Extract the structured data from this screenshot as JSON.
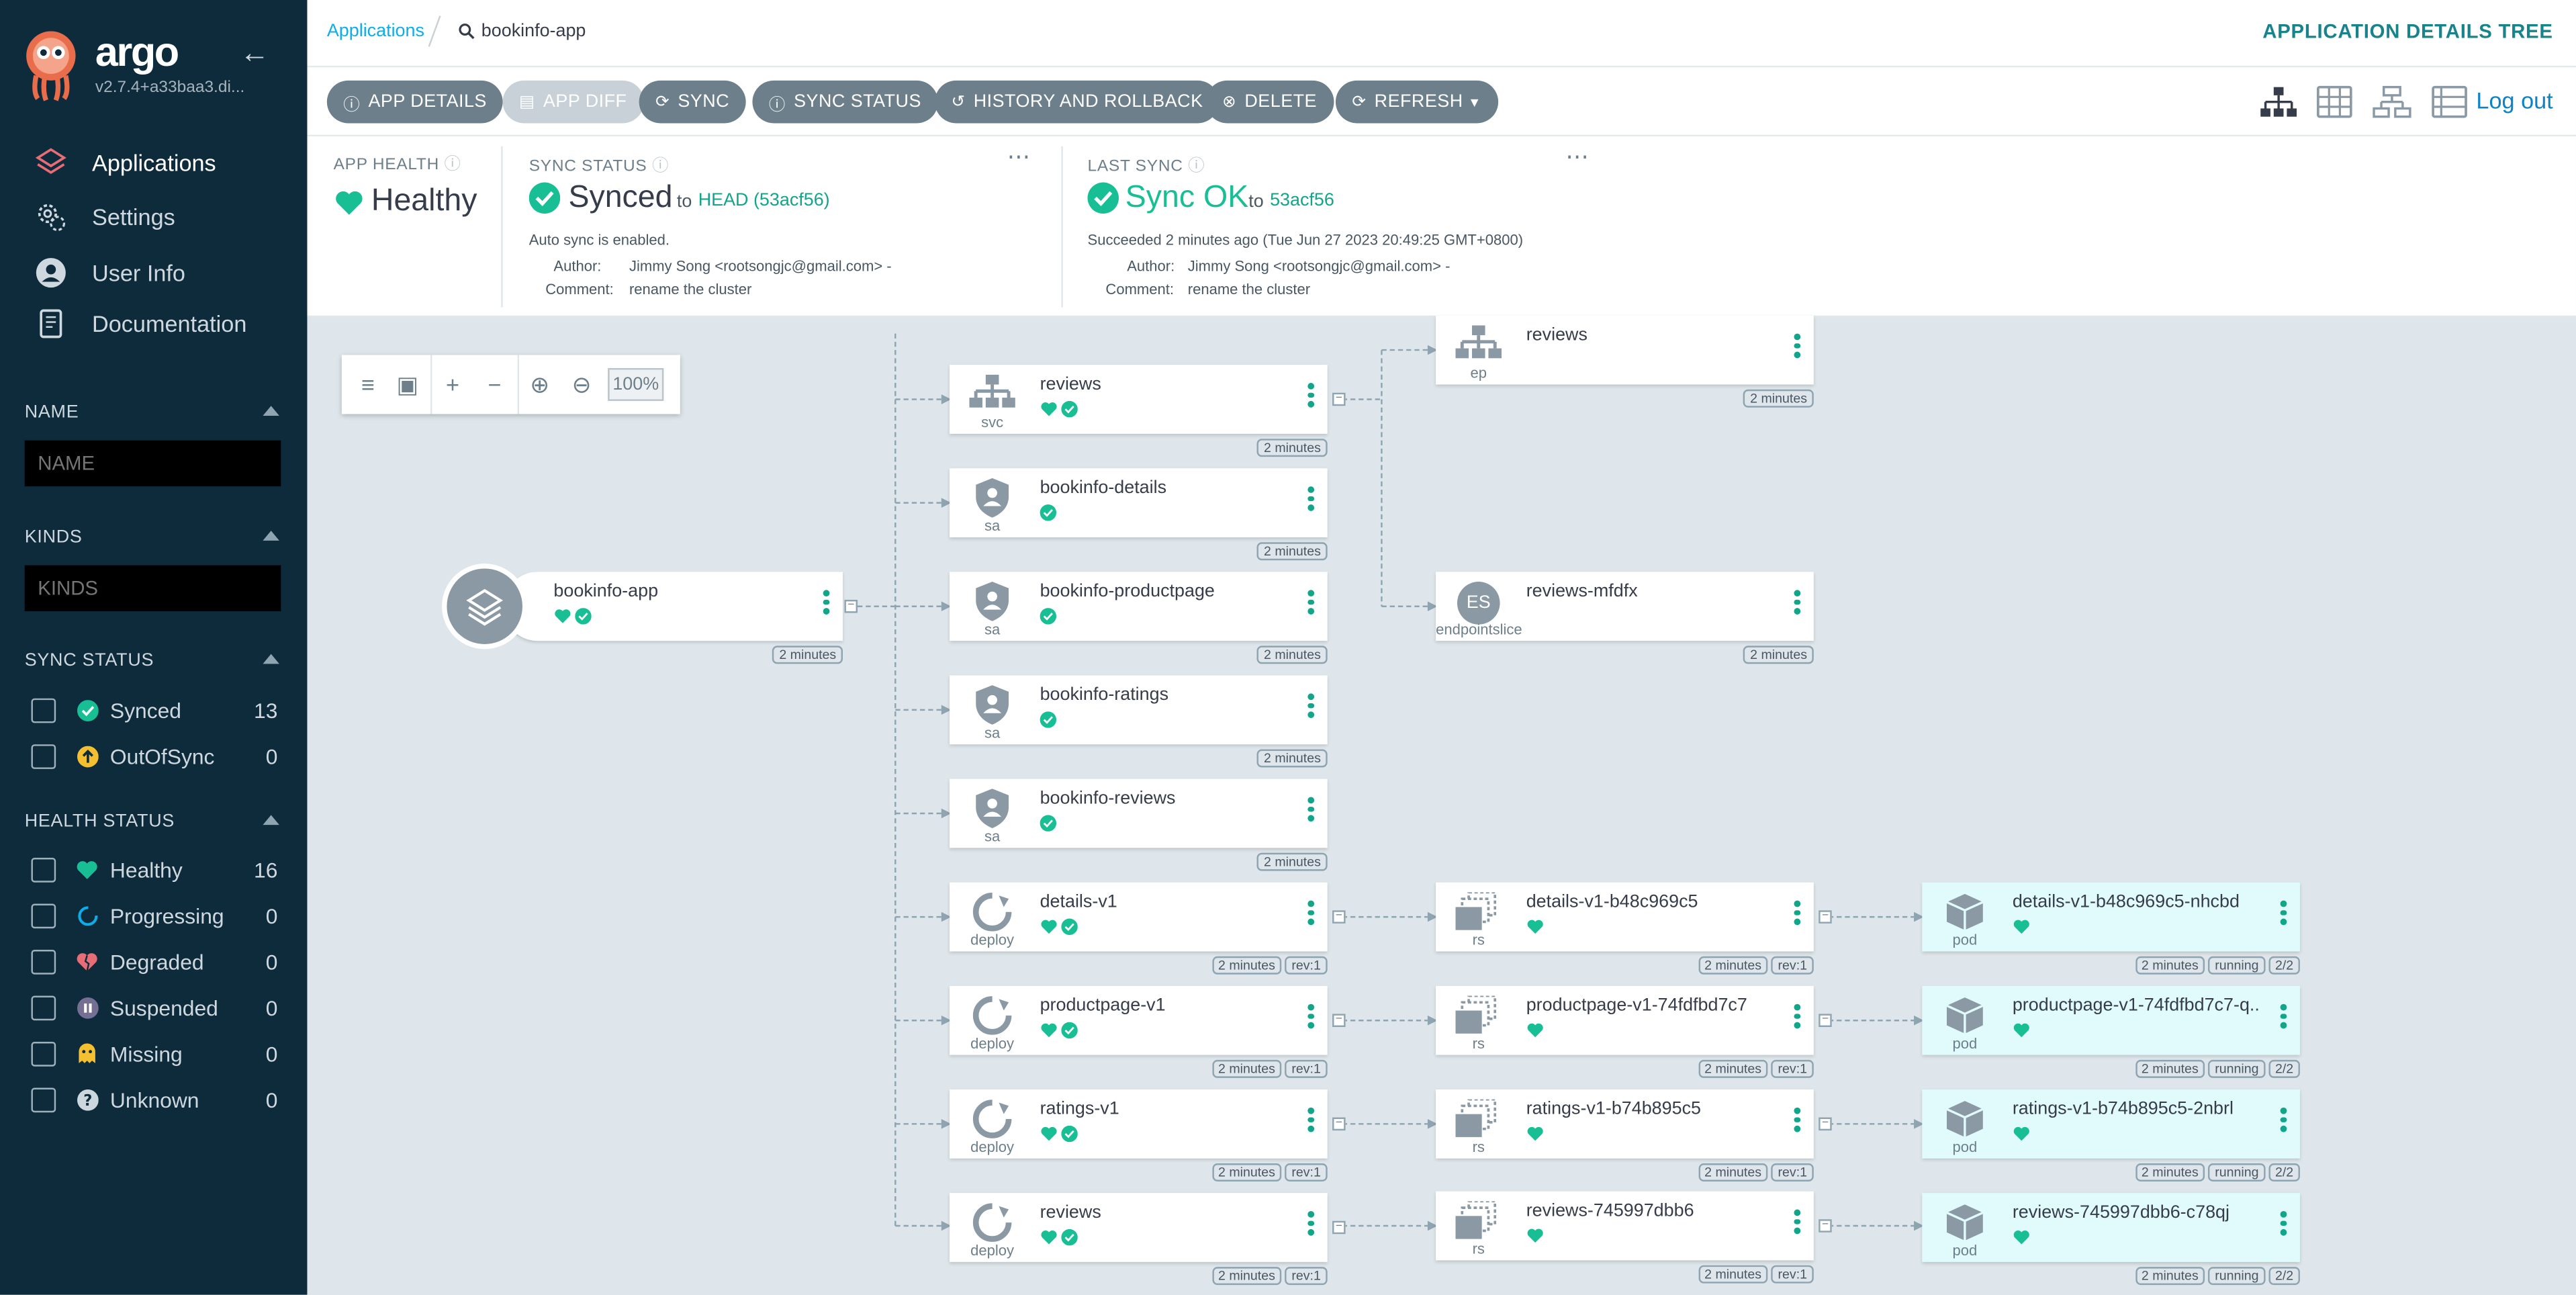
{
  "sidebar": {
    "brand": "argo",
    "version": "v2.7.4+a33baa3.di...",
    "nav": [
      {
        "label": "Applications",
        "icon": "layers-icon"
      },
      {
        "label": "Settings",
        "icon": "gears-icon"
      },
      {
        "label": "User Info",
        "icon": "user-icon"
      },
      {
        "label": "Documentation",
        "icon": "book-icon"
      }
    ],
    "filters": {
      "name_title": "NAME",
      "name_placeholder": "NAME",
      "kinds_title": "KINDS",
      "kinds_placeholder": "KINDS",
      "sync_title": "SYNC STATUS",
      "sync": [
        {
          "label": "Synced",
          "count": "13",
          "color": "#18be94"
        },
        {
          "label": "OutOfSync",
          "count": "0",
          "color": "#f4c030"
        }
      ],
      "health_title": "HEALTH STATUS",
      "health": [
        {
          "label": "Healthy",
          "count": "16",
          "color": "#18be94"
        },
        {
          "label": "Progressing",
          "count": "0",
          "color": "#0dadea"
        },
        {
          "label": "Degraded",
          "count": "0",
          "color": "#e96d76"
        },
        {
          "label": "Suspended",
          "count": "0",
          "color": "#766f94"
        },
        {
          "label": "Missing",
          "count": "0",
          "color": "#f4c030"
        },
        {
          "label": "Unknown",
          "count": "0",
          "color": "#ccd6dd"
        }
      ]
    }
  },
  "header": {
    "breadcrumb_root": "Applications",
    "breadcrumb_app": "bookinfo-app",
    "view_title": "APPLICATION DETAILS TREE",
    "logout": "Log out"
  },
  "toolbar": {
    "buttons": [
      "APP DETAILS",
      "APP DIFF",
      "SYNC",
      "SYNC STATUS",
      "HISTORY AND ROLLBACK",
      "DELETE",
      "REFRESH"
    ]
  },
  "status": {
    "health_title": "APP HEALTH",
    "health_value": "Healthy",
    "sync_title": "SYNC STATUS",
    "sync_value": "Synced",
    "sync_to": "to",
    "sync_rev": "HEAD (53acf56)",
    "auto_sync": "Auto sync is enabled.",
    "author_label": "Author:",
    "author": "Jimmy Song <rootsongjc@gmail.com> -",
    "comment_label": "Comment:",
    "comment": "rename the cluster",
    "last_title": "LAST SYNC",
    "last_value": "Sync OK",
    "last_to": "to",
    "last_rev": "53acf56",
    "succeeded": "Succeeded 2 minutes ago (Tue Jun 27 2023 20:49:25 GMT+0800)"
  },
  "zoom": {
    "percent": "100%"
  },
  "tree": {
    "root": {
      "name": "bookinfo-app",
      "age": "2 minutes"
    },
    "col1": [
      {
        "name": "reviews",
        "kind": "svc",
        "icon": "service-icon",
        "health": true,
        "tags": [
          "2 minutes"
        ]
      },
      {
        "name": "bookinfo-details",
        "kind": "sa",
        "icon": "serviceaccount-icon",
        "health": false,
        "tags": [
          "2 minutes"
        ]
      },
      {
        "name": "bookinfo-productpage",
        "kind": "sa",
        "icon": "serviceaccount-icon",
        "health": false,
        "tags": [
          "2 minutes"
        ]
      },
      {
        "name": "bookinfo-ratings",
        "kind": "sa",
        "icon": "serviceaccount-icon",
        "health": false,
        "tags": [
          "2 minutes"
        ]
      },
      {
        "name": "bookinfo-reviews",
        "kind": "sa",
        "icon": "serviceaccount-icon",
        "health": false,
        "tags": [
          "2 minutes"
        ]
      },
      {
        "name": "details-v1",
        "kind": "deploy",
        "icon": "deployment-icon",
        "health": true,
        "tags": [
          "2 minutes",
          "rev:1"
        ]
      },
      {
        "name": "productpage-v1",
        "kind": "deploy",
        "icon": "deployment-icon",
        "health": true,
        "tags": [
          "2 minutes",
          "rev:1"
        ]
      },
      {
        "name": "ratings-v1",
        "kind": "deploy",
        "icon": "deployment-icon",
        "health": true,
        "tags": [
          "2 minutes",
          "rev:1"
        ]
      },
      {
        "name": "reviews",
        "kind": "deploy",
        "icon": "deployment-icon",
        "health": true,
        "tags": [
          "2 minutes",
          "rev:1"
        ]
      }
    ],
    "col2": [
      {
        "name": "reviews",
        "kind": "ep",
        "icon": "endpoints-icon",
        "tags": [
          "2 minutes"
        ]
      },
      {
        "name": "reviews-mfdfx",
        "kind": "endpointslice",
        "icon": "endpointslice-icon",
        "icon_text": "ES",
        "tags": [
          "2 minutes"
        ]
      },
      {
        "name": "details-v1-b48c969c5",
        "kind": "rs",
        "icon": "replicaset-icon",
        "tags": [
          "2 minutes",
          "rev:1"
        ]
      },
      {
        "name": "productpage-v1-74fdfbd7c7",
        "kind": "rs",
        "icon": "replicaset-icon",
        "tags": [
          "2 minutes",
          "rev:1"
        ]
      },
      {
        "name": "ratings-v1-b74b895c5",
        "kind": "rs",
        "icon": "replicaset-icon",
        "tags": [
          "2 minutes",
          "rev:1"
        ]
      },
      {
        "name": "reviews-745997dbb6",
        "kind": "rs",
        "icon": "replicaset-icon",
        "tags": [
          "2 minutes",
          "rev:1"
        ]
      }
    ],
    "col3": [
      {
        "name": "details-v1-b48c969c5-nhcbd",
        "kind": "pod",
        "icon": "pod-icon",
        "tags": [
          "2 minutes",
          "running",
          "2/2"
        ]
      },
      {
        "name": "productpage-v1-74fdfbd7c7-q...",
        "kind": "pod",
        "icon": "pod-icon",
        "tags": [
          "2 minutes",
          "running",
          "2/2"
        ]
      },
      {
        "name": "ratings-v1-b74b895c5-2nbrl",
        "kind": "pod",
        "icon": "pod-icon",
        "tags": [
          "2 minutes",
          "running",
          "2/2"
        ]
      },
      {
        "name": "reviews-745997dbb6-c78qj",
        "kind": "pod",
        "icon": "pod-icon",
        "tags": [
          "2 minutes",
          "running",
          "2/2"
        ]
      }
    ]
  },
  "colors": {
    "sidebar": "#0e2b3c",
    "accent": "#13a58a",
    "healthy": "#18be94",
    "button": "#6d7f8b",
    "link": "#0c83c7"
  }
}
